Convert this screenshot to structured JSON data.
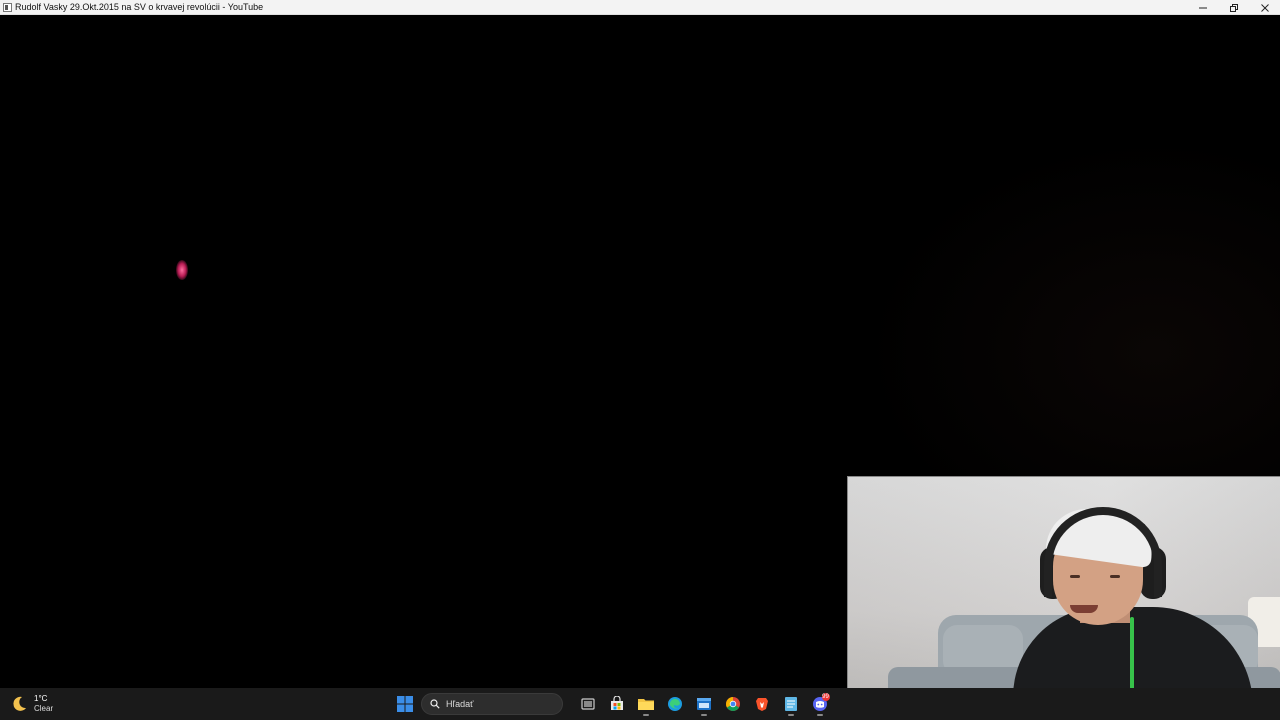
{
  "window": {
    "title": "Rudolf Vasky 29.Okt.2015 na SV o krvavej revolúcii - YouTube",
    "controls": [
      "minimize",
      "restore",
      "close"
    ]
  },
  "taskbar": {
    "weather": {
      "temperature": "1°C",
      "condition": "Clear",
      "icon": "moon-icon"
    },
    "search": {
      "placeholder": "Hľadať"
    },
    "pinned_apps": [
      {
        "name": "task-view",
        "icon": "task-view-icon"
      },
      {
        "name": "microsoft-store",
        "icon": "store-icon"
      },
      {
        "name": "file-explorer",
        "icon": "folder-icon"
      },
      {
        "name": "microsoft-edge",
        "icon": "edge-icon"
      },
      {
        "name": "app-window",
        "icon": "app-window-icon"
      },
      {
        "name": "google-chrome",
        "icon": "chrome-icon"
      },
      {
        "name": "brave-browser",
        "icon": "brave-icon"
      },
      {
        "name": "notepad",
        "icon": "notepad-icon"
      },
      {
        "name": "discord",
        "icon": "discord-icon",
        "badge": "99"
      }
    ]
  },
  "colors": {
    "titlebar_bg": "#f3f3f3",
    "taskbar_bg": "#1a1a1a",
    "video_bg": "#000000",
    "windows_blue": "#3b8ee8"
  }
}
